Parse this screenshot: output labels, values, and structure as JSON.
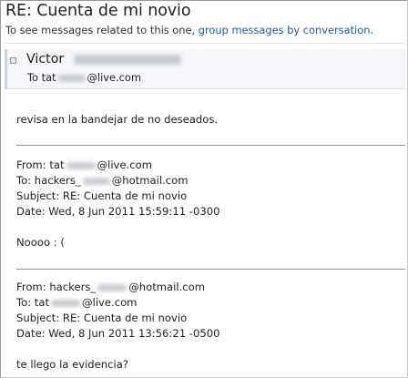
{
  "message": {
    "subject": "RE: Cuenta de mi novio",
    "hint_prefix": "To see messages related to this one,",
    "hint_link": "group messages by conversation",
    "hint_suffix": ".",
    "sender_name": "Victor",
    "to_prefix": "To tat",
    "to_domain": "@live.com",
    "body_line": "revisa en la bandejar de no deseados."
  },
  "quoted1": {
    "from_prefix": "From: tat",
    "from_domain": "@live.com",
    "to_prefix": "To: hackers_",
    "to_domain": "@hotmail.com",
    "subject": "Subject: RE: Cuenta de mi novio",
    "date": "Date: Wed, 8 Jun 2011 15:59:11 -0300",
    "body": "Noooo : ("
  },
  "quoted2": {
    "from_prefix": "From: hackers_",
    "from_domain": "@hotmail.com",
    "to_prefix": "To: tat",
    "to_domain": "@live.com",
    "subject": "Subject: RE: Cuenta de mi novio",
    "date": "Date: Wed, 8 Jun 2011 13:56:21 -0500",
    "body": "te llego la evidencia?"
  }
}
